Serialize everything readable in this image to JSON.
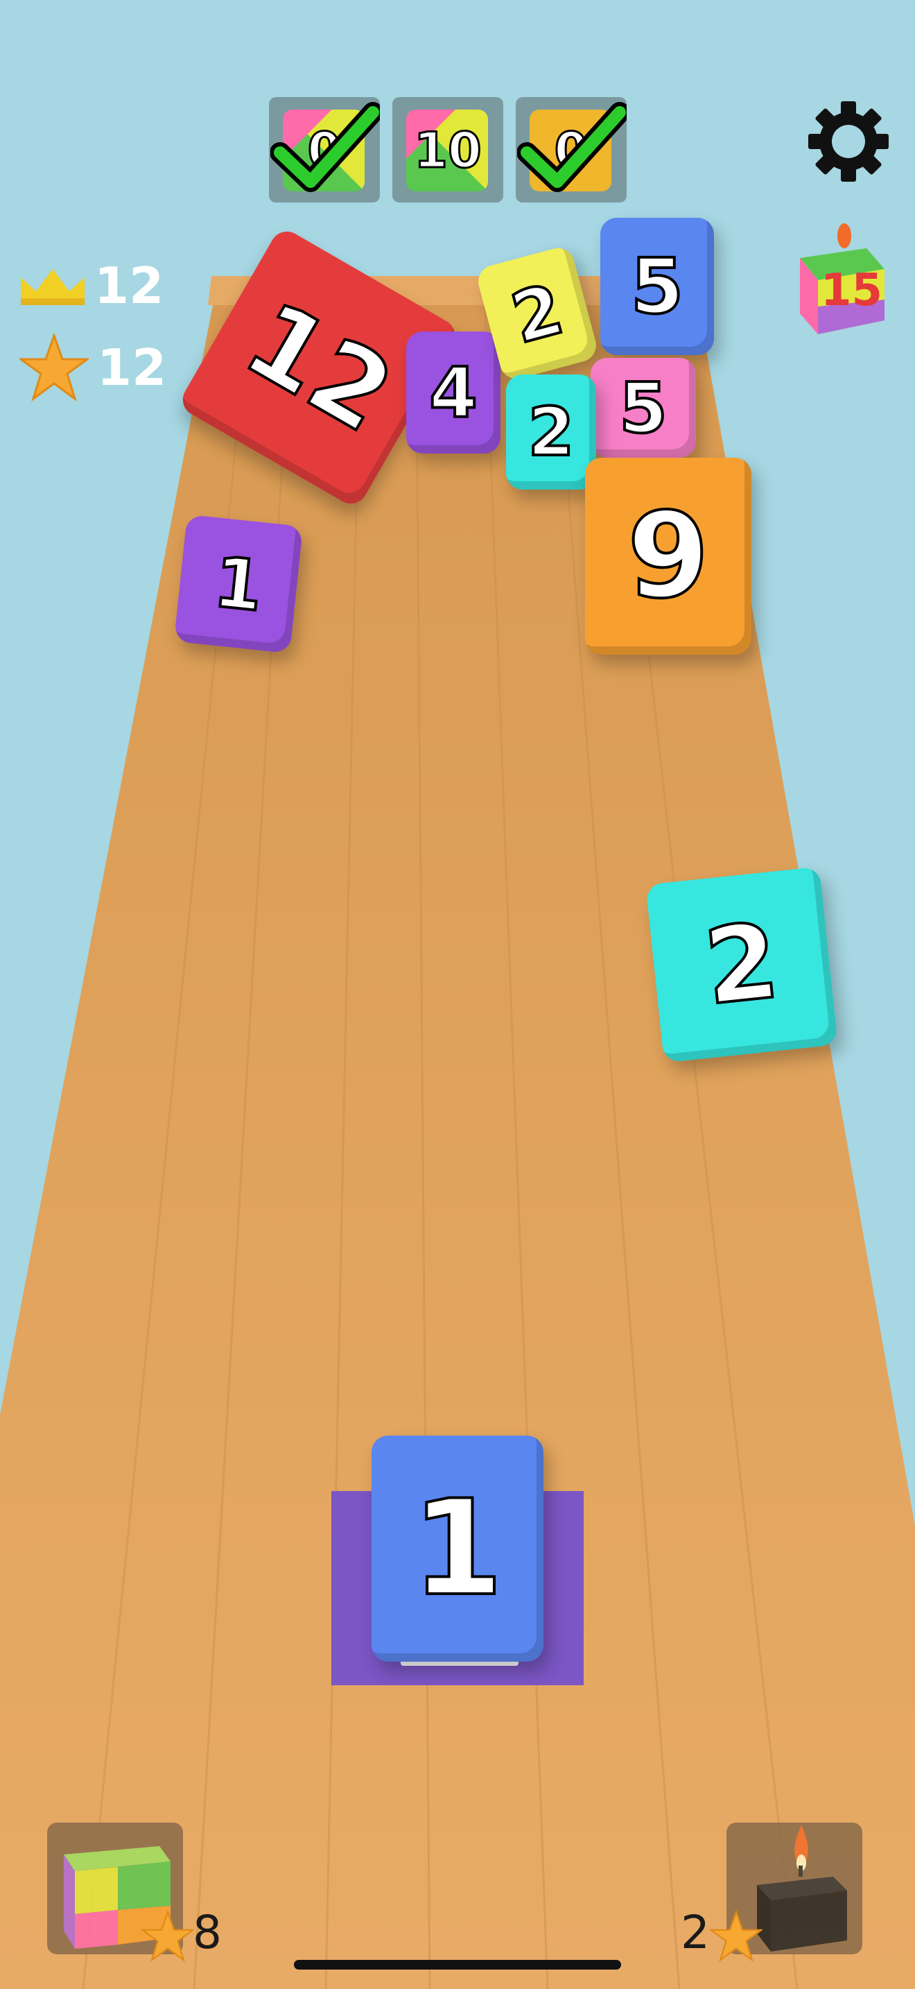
{
  "goals": [
    {
      "label": "0",
      "done": true
    },
    {
      "label": "10",
      "done": false
    },
    {
      "label": "0",
      "done": true
    }
  ],
  "stats": {
    "crowns": "12",
    "stars": "12"
  },
  "candle_goal": "15",
  "cubes": [
    {
      "value": "12",
      "color": "#e43c3c"
    },
    {
      "value": "4",
      "color": "#9a52e0"
    },
    {
      "value": "2",
      "color": "#f2f058"
    },
    {
      "value": "5",
      "color": "#5a86f0"
    },
    {
      "value": "5",
      "color": "#f77fc7"
    },
    {
      "value": "2",
      "color": "#37e6df"
    },
    {
      "value": "9",
      "color": "#f7a030"
    },
    {
      "value": "1",
      "color": "#9a52e0"
    },
    {
      "value": "2",
      "color": "#37e6df"
    }
  ],
  "shooter": {
    "value": "1",
    "color": "#5a86f0"
  },
  "powerups": {
    "rainbow_cost": "8",
    "bomb_cost": "2"
  },
  "colors": {
    "sky": "#a6d7e2",
    "wood": "#e2a45c",
    "launcher": "#7b56c4"
  }
}
